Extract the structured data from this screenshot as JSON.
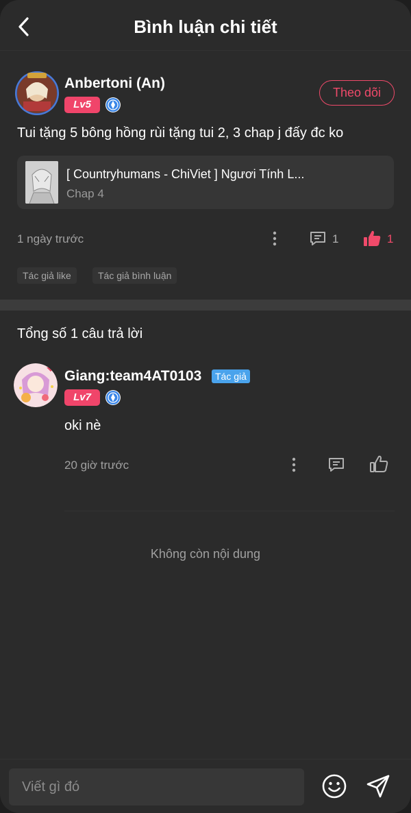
{
  "header": {
    "title": "Bình luận chi tiết",
    "back_icon": "chevron-left-icon"
  },
  "comment": {
    "user_name": "Anbertoni (An)",
    "level": "Lv5",
    "follow_label": "Theo dõi",
    "text": "Tui tặng 5 bông hồng rùi tặng tui 2, 3 chap j đấy đc ko",
    "chapter_card": {
      "title": "[ Countryhumans - ChiViet ] Ngươi Tính L...",
      "subtitle": "Chap 4"
    },
    "time": "1 ngày trước",
    "reply_count": "1",
    "like_count": "1",
    "tags": [
      "Tác giả like",
      "Tác giả bình luận"
    ]
  },
  "replies": {
    "heading": "Tổng số 1 câu trả lời",
    "items": [
      {
        "user_name": "Giang:team4AT0103",
        "author_tag": "Tác giả",
        "level": "Lv7",
        "text": "oki nè",
        "time": "20 giờ trước"
      }
    ],
    "end_text": "Không còn nội dung"
  },
  "composer": {
    "placeholder": "Viết gì đó",
    "emoji_icon": "smile-icon",
    "send_icon": "send-icon"
  },
  "colors": {
    "background": "#2b2b2b",
    "accent_pink": "#f04a6a",
    "author_blue": "#4aa3ec",
    "muted_text": "#a0a0a0"
  }
}
